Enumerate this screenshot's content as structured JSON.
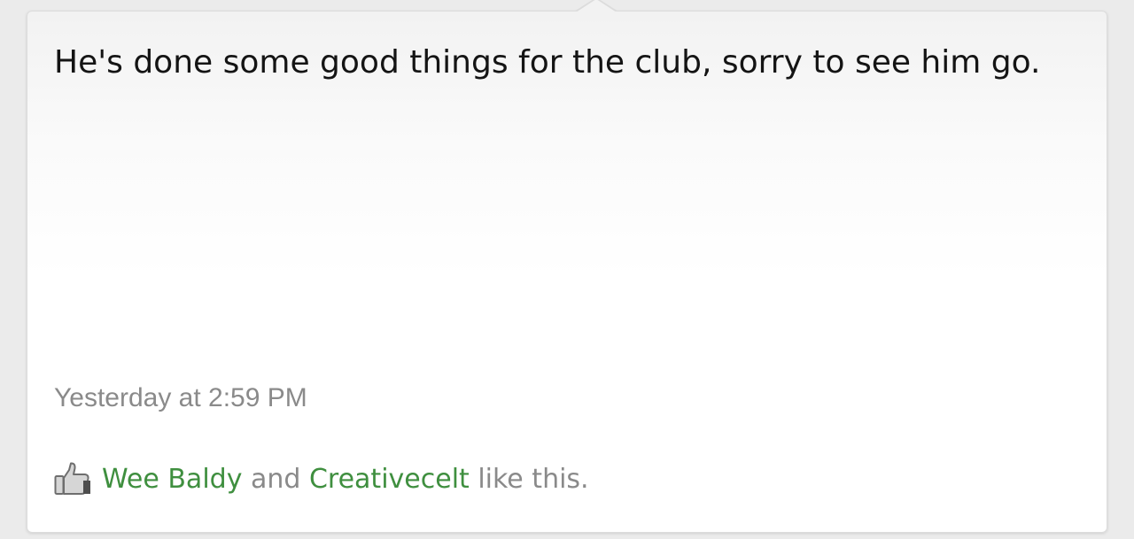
{
  "post": {
    "message": "He's done some good things for the club, sorry to see him go.",
    "timestamp": "Yesterday at 2:59 PM"
  },
  "likes": {
    "icon": "thumbs-up-icon",
    "users": [
      "Wee Baldy",
      "Creativecelt"
    ],
    "connector": " and ",
    "suffix": " like this."
  },
  "colors": {
    "link": "#3f8f3f",
    "meta_text": "#8a8a8a",
    "message_text": "#141414"
  }
}
